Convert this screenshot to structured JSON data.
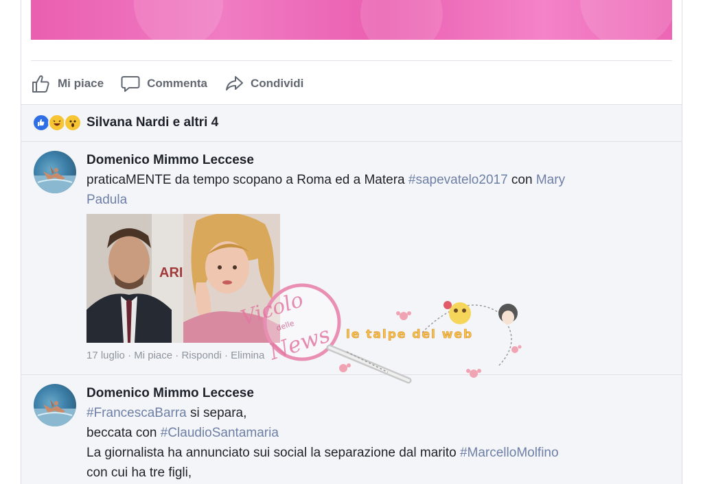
{
  "actions": {
    "like": "Mi piace",
    "comment": "Commenta",
    "share": "Condividi"
  },
  "reactions": {
    "label": "Silvana Nardi e altri 4",
    "icons": [
      "like-icon",
      "haha-icon",
      "wow-icon"
    ]
  },
  "comments": [
    {
      "author": "Domenico Mimmo Leccese",
      "text_before": "praticaMENTE da tempo scopano a Roma ed a Matera ",
      "hashtag": "#sapevatelo2017",
      "text_mid": " con ",
      "mention_part1": "Mary",
      "mention_part2": "Padula",
      "meta": {
        "date": "17 luglio",
        "like": "Mi piace",
        "reply": "Rispondi",
        "remove": "Elimina"
      }
    },
    {
      "author": "Domenico Mimmo Leccese",
      "line1_tag": "#FrancescaBarra",
      "line1_text": " si separa,",
      "line2_text": "beccata con ",
      "line2_tag": "#ClaudioSantamaria",
      "line3_text": "La giornalista ha annunciato sui social la separazione dal marito ",
      "line3_tag": "#MarcelloMolfino",
      "line4_text": "con cui ha tre figli,"
    }
  ],
  "watermark": {
    "script_1": "Vicolo",
    "script_2": "delle",
    "script_3": "News",
    "tagline": "le talpe del web"
  },
  "colors": {
    "banner": "#ea5fb0",
    "hashtag": "#6d7fa6",
    "like_blue": "#2f6ee5",
    "muted": "#8d949e"
  }
}
